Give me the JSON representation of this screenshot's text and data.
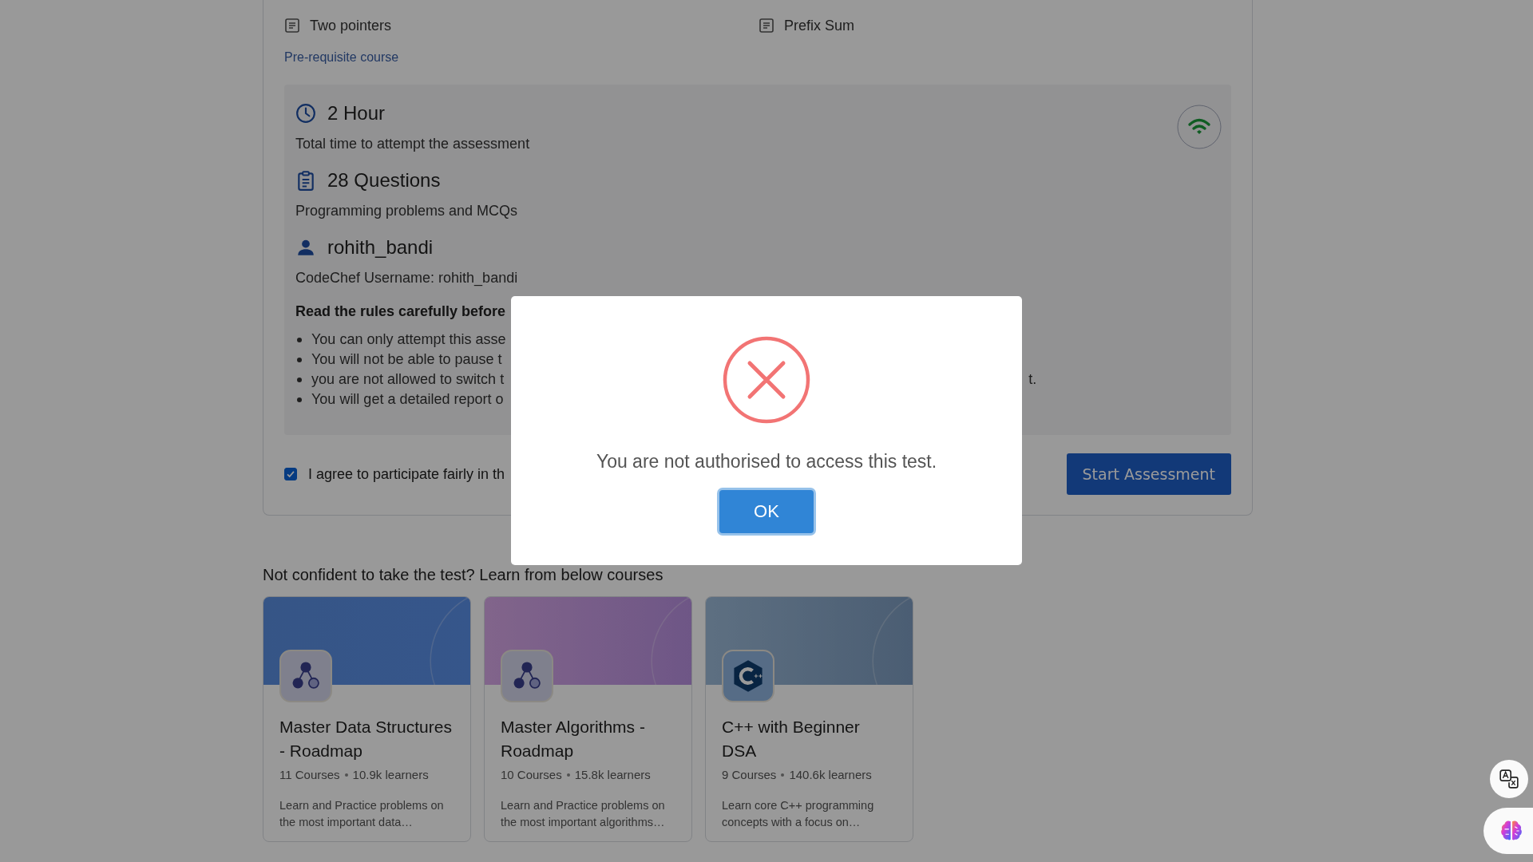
{
  "topics": [
    {
      "label": "Two pointers"
    },
    {
      "label": "Prefix Sum"
    }
  ],
  "prerequisite_link": "Pre-requisite course",
  "details": [
    {
      "kind": "time",
      "title": "2 Hour",
      "subtitle": "Total time to attempt the assessment"
    },
    {
      "kind": "questions",
      "title": "28 Questions",
      "subtitle": "Programming problems and MCQs"
    },
    {
      "kind": "user",
      "title": "rohith_bandi",
      "subtitle": "CodeChef Username: rohith_bandi"
    }
  ],
  "rules": {
    "heading": "Read the rules carefully before",
    "items": [
      {
        "text": "You can only attempt this asse"
      },
      {
        "text": "You will not be able to pause t"
      },
      {
        "text": "you are not allowed to switch t",
        "tail": "t."
      },
      {
        "text": "You will get a detailed report o"
      }
    ]
  },
  "agreement": {
    "label": "I agree to participate fairly in th",
    "checked": true
  },
  "start_button": "Start Assessment",
  "courses_heading": "Not confident to take the test? Learn from below courses",
  "courses": [
    {
      "kind": "graph",
      "title": "Master Data Structures - Roadmap",
      "courses": "11 Courses",
      "learners": "10.9k learners",
      "description": "Learn and Practice problems on the most important data…"
    },
    {
      "kind": "graph",
      "title": "Master Algorithms - Roadmap",
      "courses": "10 Courses",
      "learners": "15.8k learners",
      "description": "Learn and Practice problems on the most important algorithms…"
    },
    {
      "kind": "cpp",
      "title": "C++ with Beginner DSA",
      "courses": "9 Courses",
      "learners": "140.6k learners",
      "description": "Learn core C++ programming concepts with a focus on…"
    }
  ],
  "dialog": {
    "kind": "error",
    "message": "You are not authorised to access this test.",
    "button": "OK"
  }
}
